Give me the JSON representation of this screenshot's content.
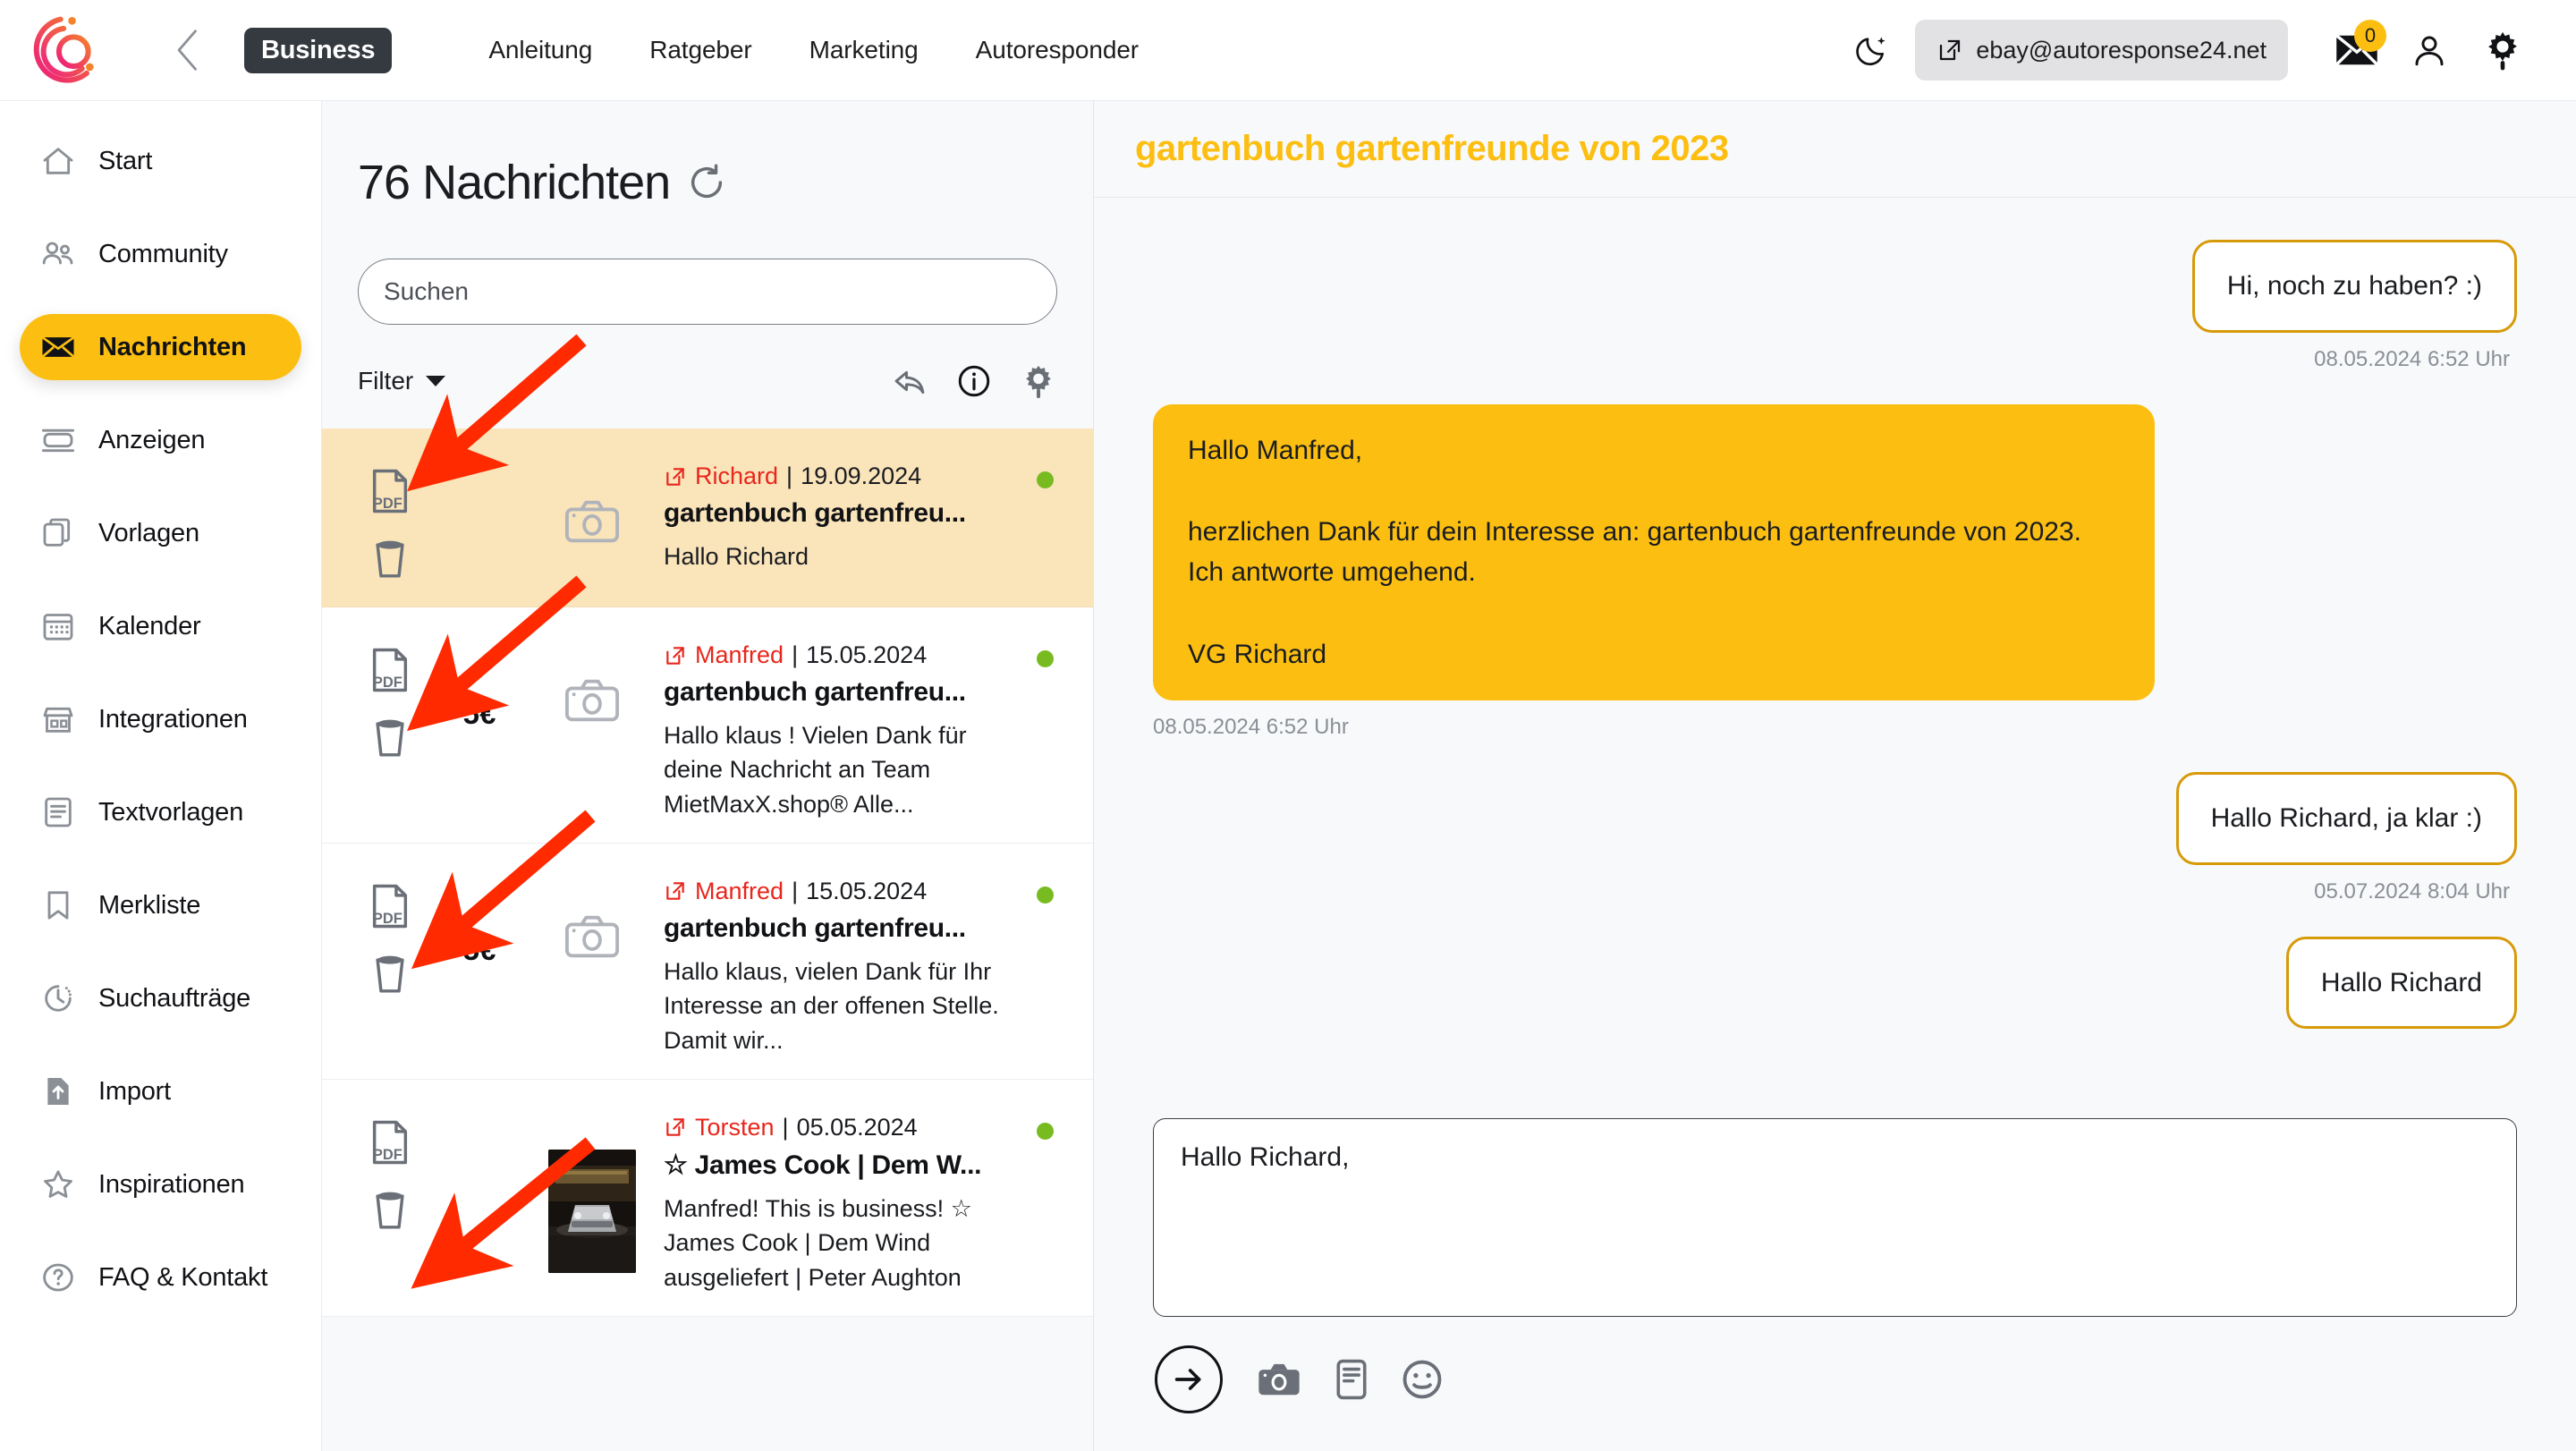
{
  "header": {
    "logo_name": "brand-logo",
    "back_icon": "chevron-left-icon",
    "plan_badge": "Business",
    "nav": [
      {
        "label": "Anleitung"
      },
      {
        "label": "Ratgeber"
      },
      {
        "label": "Marketing"
      },
      {
        "label": "Autoresponder"
      }
    ],
    "dark_mode_icon": "moon-icon",
    "account_external_icon": "external-link-icon",
    "account_email": "ebay@autoresponse24.net",
    "mail_icon": "envelope-icon",
    "mail_badge_count": "0",
    "user_icon": "user-icon",
    "settings_icon": "gear-icon"
  },
  "sidebar": {
    "items": [
      {
        "label": "Start",
        "icon": "home-icon",
        "active": false
      },
      {
        "label": "Community",
        "icon": "people-icon",
        "active": false
      },
      {
        "label": "Nachrichten",
        "icon": "envelope-icon",
        "active": true
      },
      {
        "label": "Anzeigen",
        "icon": "ad-banner-icon",
        "active": false
      },
      {
        "label": "Vorlagen",
        "icon": "copy-icon",
        "active": false
      },
      {
        "label": "Kalender",
        "icon": "calendar-icon",
        "active": false
      },
      {
        "label": "Integrationen",
        "icon": "storefront-icon",
        "active": false
      },
      {
        "label": "Textvorlagen",
        "icon": "document-text-icon",
        "active": false
      },
      {
        "label": "Merkliste",
        "icon": "bookmark-icon",
        "active": false
      },
      {
        "label": "Suchaufträge",
        "icon": "clock-search-icon",
        "active": false
      },
      {
        "label": "Import",
        "icon": "file-upload-icon",
        "active": false
      },
      {
        "label": "Inspirationen",
        "icon": "star-icon",
        "active": false
      },
      {
        "label": "FAQ & Kontakt",
        "icon": "question-circle-icon",
        "active": false
      }
    ]
  },
  "list_panel": {
    "count_label": "76 Nachrichten",
    "refresh_icon": "refresh-icon",
    "search": {
      "value": "",
      "placeholder": "Suchen",
      "icon": "search-input"
    },
    "filter_label": "Filter",
    "filter_caret_icon": "chevron-down-icon",
    "toolbar_icons": [
      {
        "name": "reply-arrow-icon"
      },
      {
        "name": "info-circle-icon"
      },
      {
        "name": "gear-icon"
      }
    ],
    "messages": [
      {
        "selected": true,
        "pdf_icon": "pdf-file-icon",
        "trash_icon": "trash-icon",
        "price": "",
        "thumb": "camera-placeholder-icon",
        "external_icon": "external-link-icon",
        "sender": "Richard",
        "separator": "|",
        "date": "19.09.2024",
        "subject": "gartenbuch gartenfreu...",
        "snippet": "Hallo Richard",
        "unread": true
      },
      {
        "selected": false,
        "pdf_icon": "pdf-file-icon",
        "trash_icon": "trash-icon",
        "price": "5€",
        "thumb": "camera-placeholder-icon",
        "external_icon": "external-link-icon",
        "sender": "Manfred",
        "separator": "|",
        "date": "15.05.2024",
        "subject": "gartenbuch gartenfreu...",
        "snippet": "Hallo klaus ! Vielen Dank für deine Nachricht an Team MietMaxX.shop® Alle...",
        "unread": true
      },
      {
        "selected": false,
        "pdf_icon": "pdf-file-icon",
        "trash_icon": "trash-icon",
        "price": "5€",
        "thumb": "camera-placeholder-icon",
        "external_icon": "external-link-icon",
        "sender": "Manfred",
        "separator": "|",
        "date": "15.05.2024",
        "subject": "gartenbuch gartenfreu...",
        "snippet": "Hallo klaus, vielen Dank für Ihr Interesse an der offenen Stelle. Damit wir...",
        "unread": true
      },
      {
        "selected": false,
        "pdf_icon": "pdf-file-icon",
        "trash_icon": "trash-icon",
        "price": "",
        "thumb": "photo-thumbnail",
        "external_icon": "external-link-icon",
        "sender": "Torsten",
        "separator": "|",
        "date": "05.05.2024",
        "subject": "☆ James Cook | Dem W...",
        "snippet": "Manfred! This is business! ☆ James Cook | Dem Wind ausgeliefert | Peter Aughton",
        "unread": true
      }
    ]
  },
  "chat": {
    "title": "gartenbuch gartenfreunde von 2023",
    "bubbles": [
      {
        "side": "right",
        "style": "outline",
        "text": "Hi, noch zu haben? :)",
        "time": "08.05.2024 6:52 Uhr"
      },
      {
        "side": "left",
        "style": "filled",
        "text": "Hallo Manfred,\n\nherzlichen Dank für dein Interesse an: gartenbuch gartenfreunde von 2023. Ich antworte umgehend.\n\nVG Richard",
        "time": "08.05.2024 6:52 Uhr"
      },
      {
        "side": "right",
        "style": "outline",
        "text": "Hallo Richard, ja klar :)",
        "time": "05.07.2024 8:04 Uhr"
      },
      {
        "side": "right",
        "style": "outline",
        "text": "Hallo Richard",
        "time": ""
      }
    ],
    "compose": {
      "value": "Hallo Richard,",
      "placeholder": "",
      "send_icon": "send-arrow-icon",
      "camera_icon": "camera-icon",
      "template_icon": "template-icon",
      "emoji_icon": "emoji-smiley-icon"
    }
  },
  "colors": {
    "accent_yellow": "#fcbf11",
    "bubble_border": "#d79a09",
    "selected_row": "#fae4ba",
    "sender_red": "#e8261c",
    "unread_green": "#78bb21",
    "annotation_red": "#ff2a00",
    "badge_dark": "#343a40"
  },
  "annotations": {
    "arrow_count": 4,
    "arrow_color": "#ff2a00",
    "arrow_target_icon": "pdf-file-icon"
  }
}
